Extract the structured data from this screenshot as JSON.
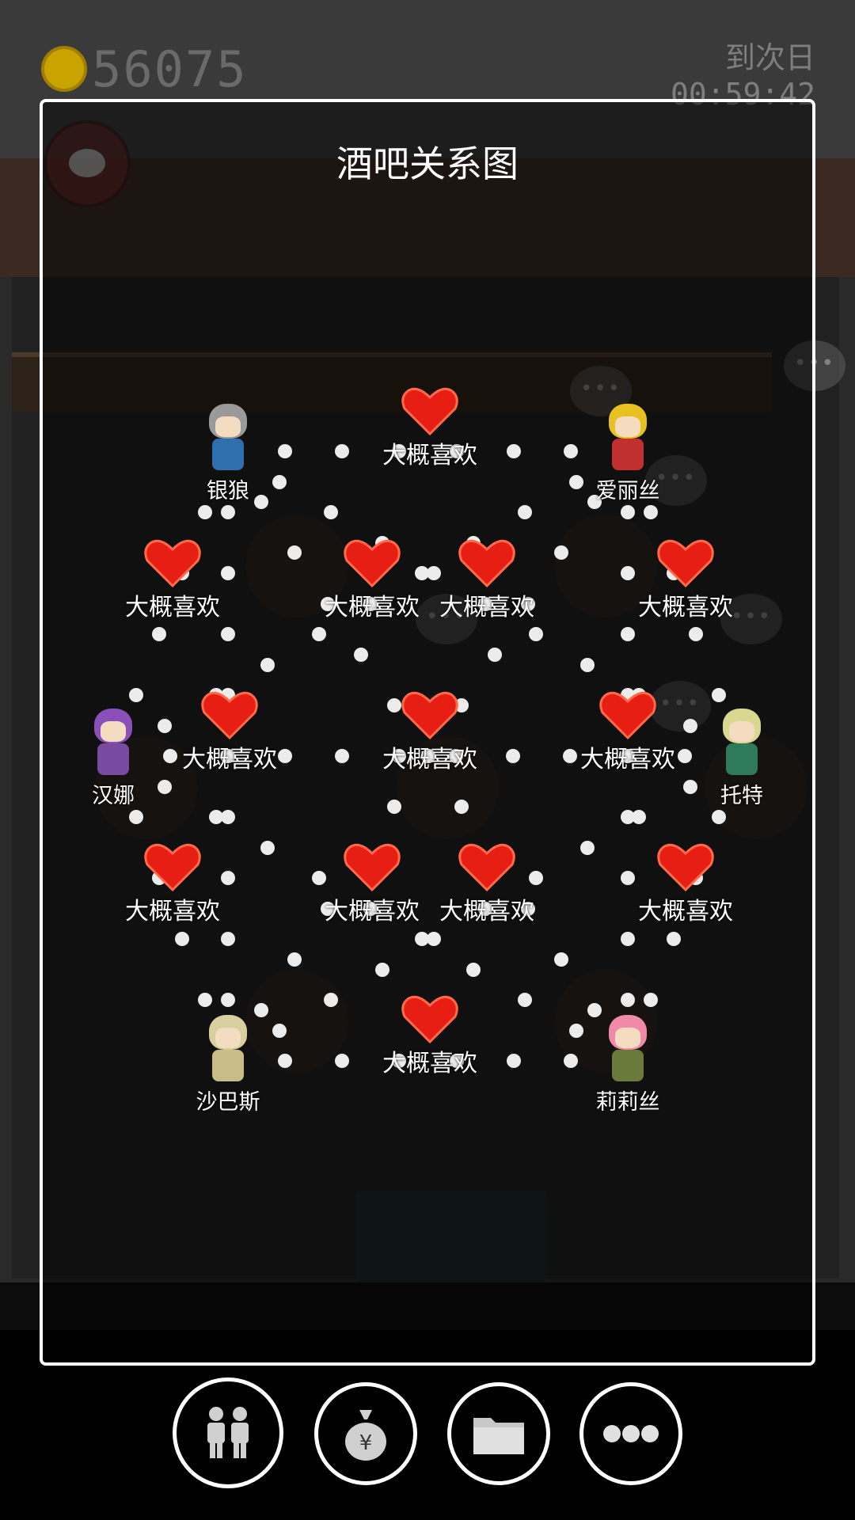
{
  "hud": {
    "coins": "56075",
    "timer_label": "到次日",
    "timer_value": "00:59:42"
  },
  "dialog": {
    "title": "酒吧关系图"
  },
  "relation_label": "大概喜欢",
  "characters": {
    "yinlang": "银狼",
    "ailisi": "爱丽丝",
    "hanna": "汉娜",
    "tuote": "托特",
    "shabasi": "沙巴斯",
    "lilisi": "莉莉丝"
  },
  "toolbar": {
    "relations_icon": "two-people-icon",
    "money_icon": "money-bag-icon",
    "folder_icon": "folder-icon",
    "more_icon": "more-dots-icon"
  },
  "colors": {
    "heart": "#e61e14",
    "dialog_border": "#ffffff",
    "coin": "#c9a400"
  }
}
